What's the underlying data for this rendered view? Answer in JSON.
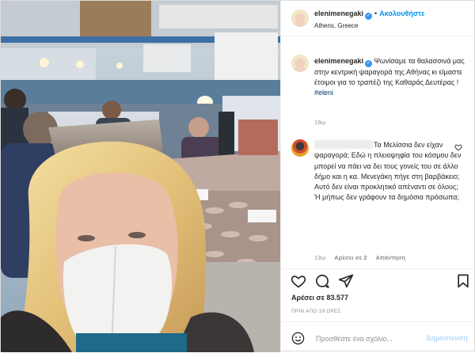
{
  "post": {
    "username": "elenimenegaki",
    "follow_label": "Ακολουθήστε",
    "location": "Athens, Greece",
    "caption": {
      "username": "elenimenegaki",
      "text": "Ψωνίσαμε τα θαλασσινά μας στην κεντρική ψαραγορά της Αθήνας κι είμαστε έτοιμοι για το τραπέζι της Καθαράς Δευτέρας !",
      "hashtag": "#eleni",
      "time": "19ω"
    },
    "comment": {
      "text": "Τα Μελίσσια δεν είχαν ψαραγορά; Εδώ η πλειοψηφία του κόσμου δεν μπορεί να πάει να δει τους γονείς του σε άλλο δήμο και η κα. Μενεγάκη πήγε στη βαρβάκειο; Αυτό δεν είναι προκλητικό απέναντι σε όλους; Ή μήπως δεν γράφουν τα δημόσια πρόσωπα;",
      "time": "13ω",
      "likes": "Αρέσει σε 2",
      "reply_label": "Απάντηση"
    },
    "likes": "Αρέσει σε 83.577",
    "ago": "ΠΡΙΝ ΑΠΟ 19 ΩΡΕΣ",
    "comment_placeholder": "Προσθέστε ένα σχόλιο...",
    "post_button": "Δημοσίευση",
    "icons": {
      "like": "heart-icon",
      "comment": "comment-bubble-icon",
      "share": "paper-plane-icon",
      "save": "bookmark-icon",
      "emoji": "smiley-icon",
      "verified": "verified-badge-icon",
      "comment_like": "small-heart-icon"
    },
    "colors": {
      "accent": "#0095f6",
      "verified": "#3897f0",
      "post_button_disabled": "#b3dbff",
      "muted_text": "#8e8e8e"
    }
  }
}
